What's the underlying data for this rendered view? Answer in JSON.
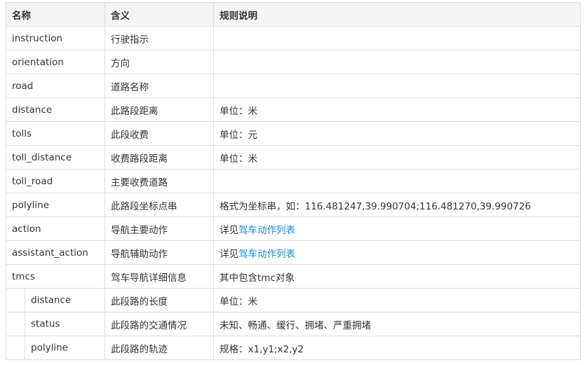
{
  "headers": [
    "名称",
    "含义",
    "规则说明"
  ],
  "rows": [
    {
      "name": "instruction",
      "meaning": "行驶指示",
      "rule_prefix": "",
      "rule_link": ""
    },
    {
      "name": "orientation",
      "meaning": "方向",
      "rule_prefix": "",
      "rule_link": ""
    },
    {
      "name": "road",
      "meaning": "道路名称",
      "rule_prefix": "",
      "rule_link": ""
    },
    {
      "name": "distance",
      "meaning": "此路段距离",
      "rule_prefix": "单位：米",
      "rule_link": ""
    },
    {
      "name": "tolls",
      "meaning": "此段收费",
      "rule_prefix": "单位：元",
      "rule_link": ""
    },
    {
      "name": "toll_distance",
      "meaning": "收费路段距离",
      "rule_prefix": "单位：米",
      "rule_link": ""
    },
    {
      "name": "toll_road",
      "meaning": "主要收费道路",
      "rule_prefix": "",
      "rule_link": ""
    },
    {
      "name": "polyline",
      "meaning": "此路段坐标点串",
      "rule_prefix": "格式为坐标串，如：116.481247,39.990704;116.481270,39.990726",
      "rule_link": ""
    },
    {
      "name": "action",
      "meaning": "导航主要动作",
      "rule_prefix": "详见",
      "rule_link": "驾车动作列表"
    },
    {
      "name": "assistant_action",
      "meaning": "导航辅助动作",
      "rule_prefix": "详见",
      "rule_link": "驾车动作列表"
    },
    {
      "name": "tmcs",
      "meaning": "驾车导航详细信息",
      "rule_prefix": "其中包含tmc对象",
      "rule_link": ""
    }
  ],
  "sub_rows": [
    {
      "name": "distance",
      "meaning": "此段路的长度",
      "rule": "单位：米"
    },
    {
      "name": "status",
      "meaning": "此段路的交通情况",
      "rule": "未知、畅通、缓行、拥堵、严重拥堵"
    },
    {
      "name": "polyline",
      "meaning": "此段路的轨迹",
      "rule": "规格：x1,y1;x2,y2"
    }
  ],
  "colors": {
    "link": "#1a8ad6",
    "header_bg": "#f5f5f5",
    "border": "#dddddd",
    "text": "#333333"
  }
}
